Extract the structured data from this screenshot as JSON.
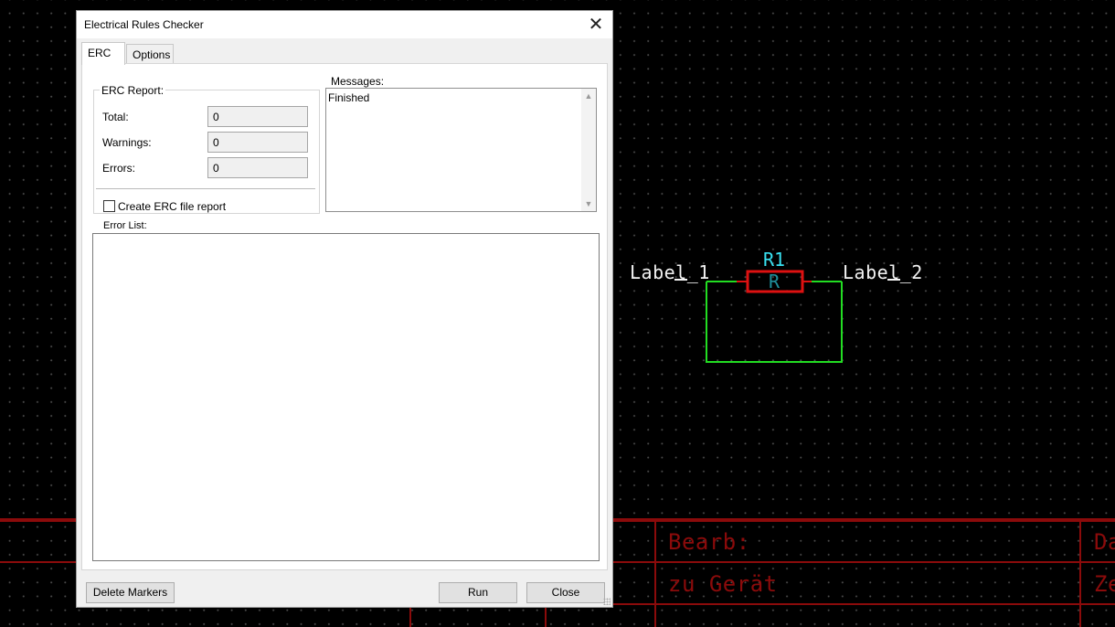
{
  "schematic": {
    "label_1": "Label_1",
    "label_2": "Label_2",
    "resistor_ref": "R1",
    "resistor_value": "R",
    "title_block": {
      "bearb": "Bearb:",
      "zu_geraet": "zu Gerät",
      "right_top": "Da",
      "right_bottom": "Ze"
    },
    "colors": {
      "wire": "#22dd22",
      "component": "#dd1111",
      "reference": "#38e0f0",
      "frame": "#8b0b0b"
    }
  },
  "dialog": {
    "title": "Electrical Rules Checker",
    "tabs": [
      {
        "label": "ERC",
        "active": true
      },
      {
        "label": "Options",
        "active": false
      }
    ],
    "erc_report": {
      "title": "ERC Report:",
      "total_label": "Total:",
      "total_value": "0",
      "warnings_label": "Warnings:",
      "warnings_value": "0",
      "errors_label": "Errors:",
      "errors_value": "0",
      "create_report_label": "Create ERC file report",
      "create_report_checked": false
    },
    "messages": {
      "title": "Messages:",
      "text": "Finished"
    },
    "error_list": {
      "title": "Error List:"
    },
    "buttons": {
      "delete_markers": "Delete Markers",
      "run": "Run",
      "close": "Close"
    }
  }
}
